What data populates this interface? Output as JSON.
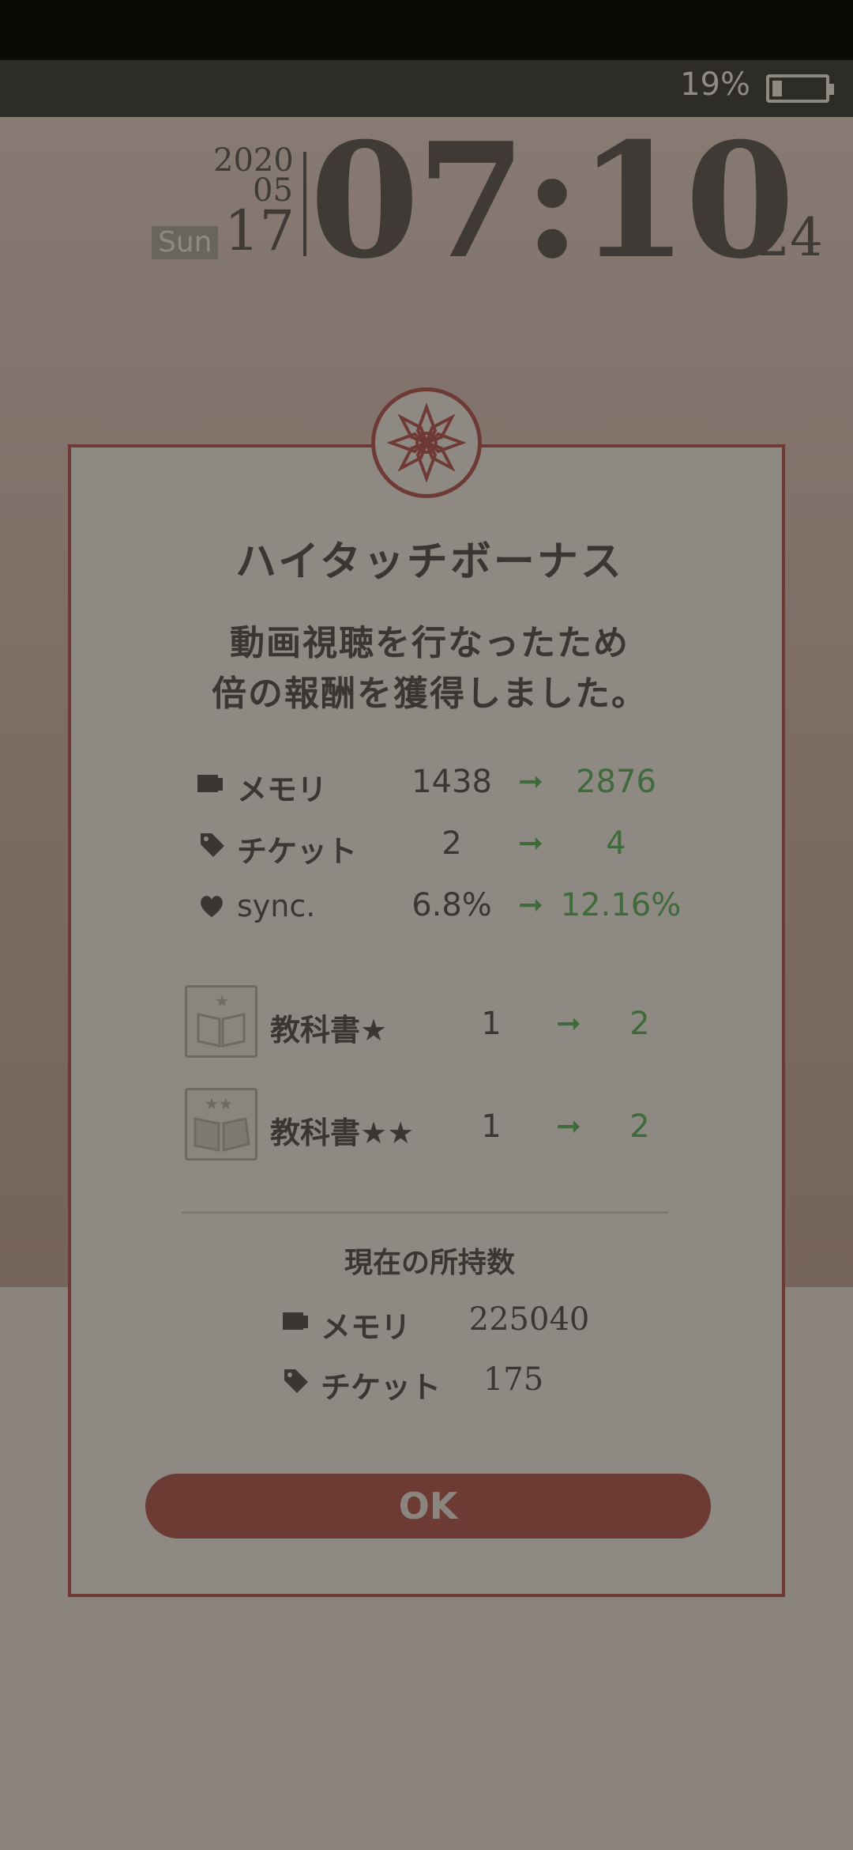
{
  "status": {
    "battery_text": "19%",
    "battery_level": 0.19
  },
  "clock": {
    "year": "2020",
    "month": "05",
    "weekday": "Sun",
    "day": "17",
    "time": "07:10",
    "seconds": "24"
  },
  "dialog": {
    "title": "ハイタッチボーナス",
    "message_line1": "動画視聴を行なったため",
    "message_line2": "倍の報酬を獲得しました。",
    "rewards": [
      {
        "icon": "memory-icon",
        "label": "メモリ",
        "before": "1438",
        "after": "2876"
      },
      {
        "icon": "ticket-icon",
        "label": "チケット",
        "before": "2",
        "after": "4"
      },
      {
        "icon": "heart-icon",
        "label": "sync.",
        "before": "6.8%",
        "after": "12.16%"
      }
    ],
    "items": [
      {
        "icon": "textbook-1star-icon",
        "label": "教科書★",
        "before": "1",
        "after": "2"
      },
      {
        "icon": "textbook-2star-icon",
        "label": "教科書★★",
        "before": "1",
        "after": "2"
      }
    ],
    "arrow": "➞",
    "holdings_title": "現在の所持数",
    "holdings": [
      {
        "icon": "memory-icon",
        "label": "メモリ",
        "value": "225040"
      },
      {
        "icon": "ticket-icon",
        "label": "チケット",
        "value": "175"
      }
    ],
    "ok_label": "OK"
  },
  "colors": {
    "accent": "#6f3a35",
    "increase": "#3f6a3a",
    "text": "#3b3633"
  }
}
